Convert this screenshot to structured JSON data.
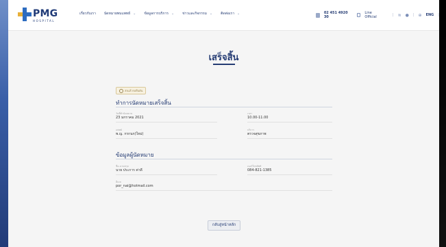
{
  "header": {
    "logo_text": "PMG",
    "logo_sub": "HOSPITAL",
    "nav": [
      {
        "label": "เกี่ยวกับเรา",
        "has_caret": false
      },
      {
        "label": "นัดหมายพบแพทย์",
        "has_caret": true
      },
      {
        "label": "ข้อมูลการบริการ",
        "has_caret": true
      },
      {
        "label": "ข่าวและกิจกรรม",
        "has_caret": true
      },
      {
        "label": "ติดต่อเรา",
        "has_caret": true
      }
    ],
    "phone": "02 451 4920 30",
    "line": "Line Official",
    "lang": "ENG"
  },
  "page_title": "เสร็จสิ้น",
  "status_badge": "ส่งแล้วรอยืนยัน",
  "sections": {
    "appointment": {
      "title": "ทำการนัดหมายเสร็จสิ้น",
      "date_label": "วันที่ทำนัดหมาย",
      "date_value": "23 มกราคม 2021",
      "time_label": "เวลา",
      "time_value": "10.00-11.00",
      "doctor_label": "แพทย์",
      "doctor_value": "พ.ญ. กรกนก(ใหม่)",
      "service_label": "บริการ",
      "service_value": "ตรวจสุขภาพ"
    },
    "patient": {
      "title": "ข้อมูลผู้นัดหมาย",
      "name_label": "ชื่อ-นามสกุล",
      "name_value": "นาย ประการ ค่าดี",
      "phone_label": "เบอร์โทรศัพท์",
      "phone_value": "084-821-1385",
      "email_label": "อีเมล",
      "email_value": "por_nai@hotmail.com"
    }
  },
  "back_button": "กลับสู่หน้าหลัก",
  "colors": {
    "brand": "#243b73",
    "accent": "#d9c89a"
  }
}
